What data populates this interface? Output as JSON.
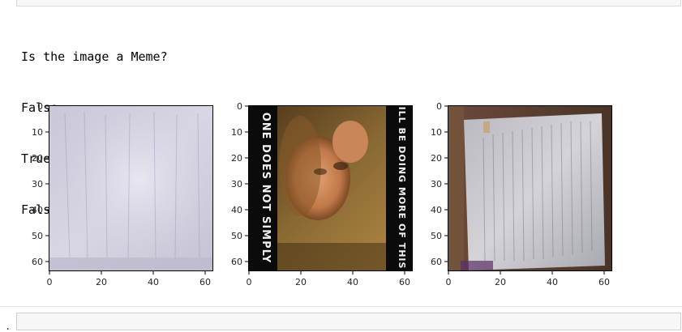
{
  "output": {
    "lines": [
      "Is the image a Meme?",
      "False",
      "True",
      "False"
    ]
  },
  "plots": [
    {
      "name": "document-scan-image",
      "y_ticks": [
        "0",
        "10",
        "20",
        "30",
        "40",
        "50",
        "60"
      ],
      "x_ticks": [
        "0",
        "20",
        "40",
        "60"
      ]
    },
    {
      "name": "meme-image",
      "y_ticks": [
        "0",
        "10",
        "20",
        "30",
        "40",
        "50",
        "60"
      ],
      "x_ticks": [
        "0",
        "20",
        "40",
        "60"
      ],
      "meme_text_left": "ONE DOES NOT SIMPLY",
      "meme_text_right": "ILL BE DOING MORE OF THIS"
    },
    {
      "name": "paper-page-image",
      "y_ticks": [
        "0",
        "10",
        "20",
        "30",
        "40",
        "50",
        "60"
      ],
      "x_ticks": [
        "0",
        "20",
        "40",
        "60"
      ]
    }
  ],
  "bottom_cell": {
    "prompt": "."
  }
}
